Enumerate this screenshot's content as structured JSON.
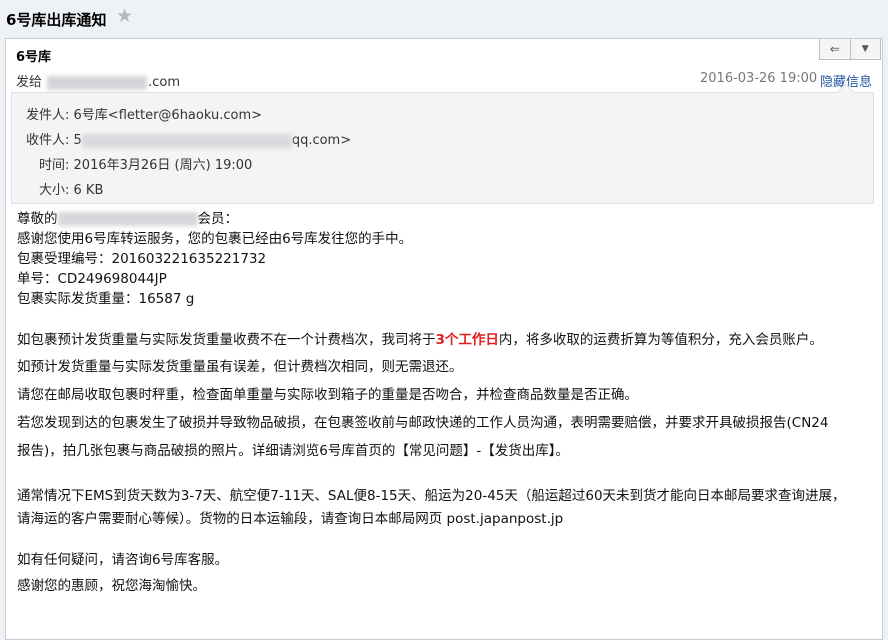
{
  "header": {
    "subject": "6号库出库通知",
    "star_glyph": "★"
  },
  "message": {
    "sender_display": "6号库",
    "to_prefix": "发给",
    "to_suffix": ".com",
    "date": "2016-03-26 19:00",
    "hide_details": "隐藏信息",
    "reply_glyph": "⇐",
    "menu_glyph": "▼"
  },
  "details": {
    "from_label": "发件人:",
    "from_value": "6号库<fletter@6haoku.com>",
    "to_label": "收件人:",
    "to_prefix": "5",
    "to_suffix": "qq.com>",
    "time_label": "时间:",
    "time_value": "2016年3月26日 (周六) 19:00",
    "size_label": "大小:",
    "size_value": "6 KB"
  },
  "body": {
    "greeting_prefix": "尊敬的",
    "greeting_suffix": "会员：",
    "line_thanks": "感谢您使用6号库转运服务，您的包裹已经由6号库发往您的手中。",
    "line_accept": "包裹受理编号：201603221635221732",
    "line_tracking": "单号：CD249698044JP",
    "line_weight": "包裹实际发货重量：16587 g",
    "p1_pre": "如包裹预计发货重量与实际发货重量收费不在一个计费档次，我司将于",
    "p1_red": "3个工作日",
    "p1_post": "内，将多收取的运费折算为等值积分，充入会员账户。",
    "p2": "如预计发货重量与实际发货重量虽有误差，但计费档次相同，则无需退还。",
    "p3": "请您在邮局收取包裹时秤重，检查面单重量与实际收到箱子的重量是否吻合，并检查商品数量是否正确。",
    "p4a": "若您发现到达的包裹发生了破损并导致物品破损，在包裹签收前与邮政快递的工作人员沟通，表明需要赔偿，并要求开具破损报告(CN24",
    "p4b": "报告)，拍几张包裹与商品破损的照片。详细请浏览6号库首页的【常见问题】-【发货出库】。",
    "p5a": "通常情况下EMS到货天数为3-7天、航空便7-11天、SAL便8-15天、船运为20-45天（船运超过60天未到货才能向日本邮局要求查询进展，",
    "p5b": "请海运的客户需要耐心等候）。货物的日本运输段，请查询日本邮局网页 post.japanpost.jp",
    "p6": "如有任何疑问，请咨询6号库客服。",
    "p7": "感谢您的惠顾，祝您海淘愉快。"
  }
}
